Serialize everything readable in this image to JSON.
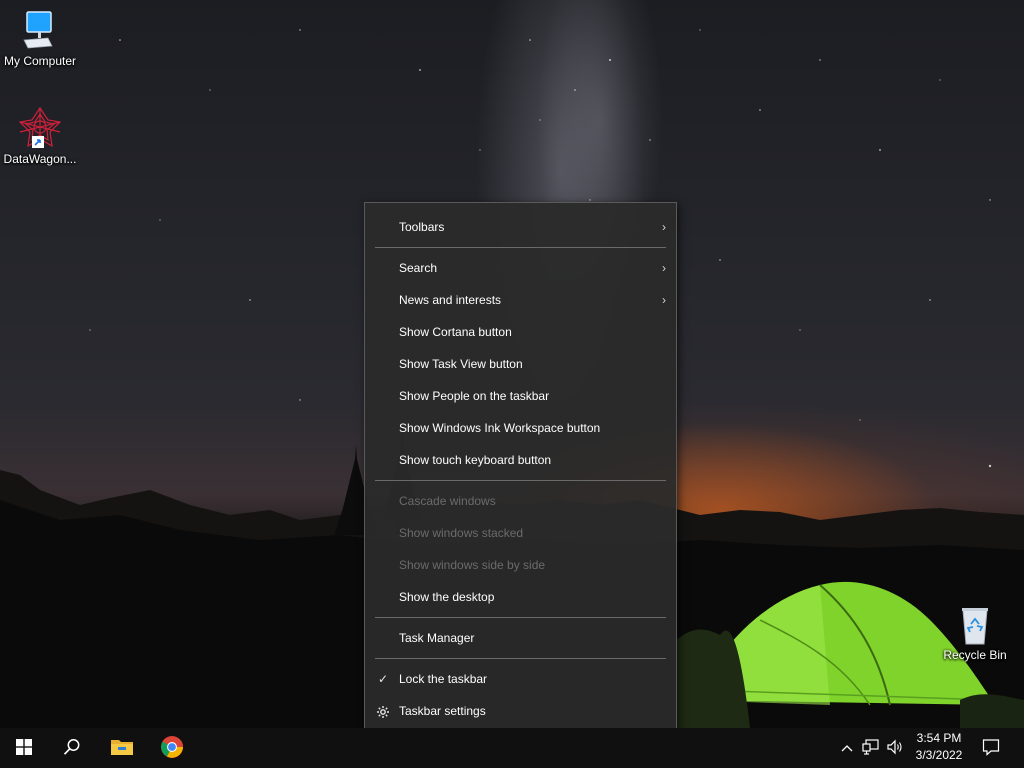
{
  "desktop": {
    "icons": [
      {
        "label": "My Computer"
      },
      {
        "label": "DataWagon..."
      },
      {
        "label": "Recycle Bin"
      }
    ]
  },
  "context_menu": {
    "items": [
      {
        "label": "Toolbars",
        "has_submenu": true,
        "enabled": true
      },
      {
        "label": "Search",
        "has_submenu": true,
        "enabled": true
      },
      {
        "label": "News and interests",
        "has_submenu": true,
        "enabled": true
      },
      {
        "label": "Show Cortana button",
        "enabled": true
      },
      {
        "label": "Show Task View button",
        "enabled": true
      },
      {
        "label": "Show People on the taskbar",
        "enabled": true
      },
      {
        "label": "Show Windows Ink Workspace button",
        "enabled": true
      },
      {
        "label": "Show touch keyboard button",
        "enabled": true
      },
      {
        "label": "Cascade windows",
        "enabled": false
      },
      {
        "label": "Show windows stacked",
        "enabled": false
      },
      {
        "label": "Show windows side by side",
        "enabled": false
      },
      {
        "label": "Show the desktop",
        "enabled": true
      },
      {
        "label": "Task Manager",
        "enabled": true
      },
      {
        "label": "Lock the taskbar",
        "enabled": true,
        "checked": true
      },
      {
        "label": "Taskbar settings",
        "enabled": true,
        "icon": "gear-icon"
      }
    ],
    "submenu_glyph": "›",
    "check_glyph": "✓"
  },
  "taskbar": {
    "buttons": [
      {
        "name": "start-button",
        "icon": "windows-logo-icon"
      },
      {
        "name": "search-button",
        "icon": "search-icon"
      },
      {
        "name": "file-explorer-button",
        "icon": "folder-icon"
      },
      {
        "name": "chrome-button",
        "icon": "chrome-icon"
      }
    ],
    "tray": {
      "overflow_glyph": "^",
      "icons": [
        "chevron-up-icon",
        "network-icon",
        "speaker-icon"
      ]
    },
    "clock": {
      "time": "3:54 PM",
      "date": "3/3/2022"
    }
  },
  "colors": {
    "menu_bg": "#2b2b2b",
    "menu_disabled_text": "#6b6b6b",
    "taskbar_bg": "#101010",
    "tent_green": "#7fd32a"
  }
}
